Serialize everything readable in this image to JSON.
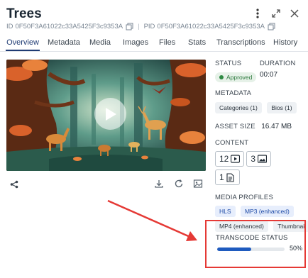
{
  "header": {
    "title": "Trees",
    "id_label": "ID",
    "id_value": "0F50F3A61022c33A5425F3c9353A",
    "pid_label": "PID",
    "pid_value": "0F50F3A61022c33A5425F3c9353A",
    "icons": [
      "more-vertical-icon",
      "expand-icon",
      "close-icon"
    ]
  },
  "tabs": [
    "Overview",
    "Metadata",
    "Media",
    "Images",
    "Files",
    "Stats",
    "Transcriptions",
    "History"
  ],
  "active_tab": "Overview",
  "player": {
    "play_icon": "play-icon"
  },
  "toolbar": {
    "icons": [
      "share-icon",
      "download-icon",
      "refresh-icon",
      "image-icon"
    ]
  },
  "details": {
    "status_label": "STATUS",
    "status_value": "Approved",
    "duration_label": "DURATION",
    "duration_value": "00:07",
    "metadata_label": "METADATA",
    "metadata_chips": [
      "Categories (1)",
      "Bios (1)"
    ],
    "asset_size_label": "ASSET SIZE",
    "asset_size_value": "16.47 MB",
    "content_label": "CONTENT",
    "content_counts": {
      "video": "12",
      "image": "3",
      "document": "1"
    },
    "media_profiles_label": "MEDIA PROFILES",
    "media_profiles": [
      "HLS",
      "MP3 (enhanced)",
      "MP4 (enhanced)",
      "Thumbnail"
    ]
  },
  "transcode": {
    "label": "TRANSCODE STATUS",
    "percent_text": "50%",
    "progress": 0.5
  },
  "colors": {
    "accent": "#1f3b73",
    "progress": "#1f5bbf",
    "highlight": "#e53935",
    "approved": "#2f8a43"
  }
}
